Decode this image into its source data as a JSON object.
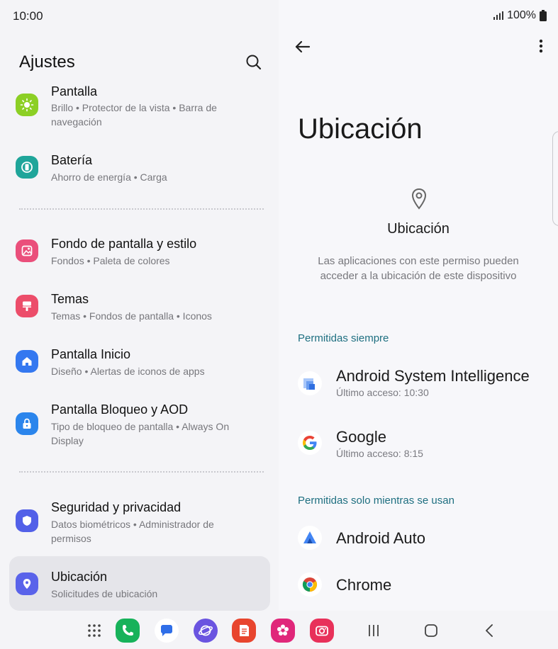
{
  "status": {
    "time": "10:00",
    "battery": "100%"
  },
  "left": {
    "title": "Ajustes",
    "items": [
      {
        "title": "Pantalla",
        "subtitle": "Brillo • Protector de la vista • Barra de navegación",
        "color": "#8ccf25",
        "icon": "sun-icon"
      },
      {
        "title": "Batería",
        "subtitle": "Ahorro de energía • Carga",
        "color": "#1fa59a",
        "icon": "battery-icon"
      },
      {
        "title": "Fondo de pantalla y estilo",
        "subtitle": "Fondos • Paleta de colores",
        "color": "#ea4f7b",
        "icon": "wallpaper-icon"
      },
      {
        "title": "Temas",
        "subtitle": "Temas • Fondos de pantalla • Iconos",
        "color": "#ec4d6a",
        "icon": "theme-brush-icon"
      },
      {
        "title": "Pantalla Inicio",
        "subtitle": "Diseño • Alertas de iconos de apps",
        "color": "#3478f0",
        "icon": "home-icon"
      },
      {
        "title": "Pantalla Bloqueo y AOD",
        "subtitle": "Tipo de bloqueo de pantalla • Always On Display",
        "color": "#2b85ec",
        "icon": "lock-icon"
      },
      {
        "title": "Seguridad y privacidad",
        "subtitle": "Datos biométricos • Administrador de permisos",
        "color": "#5260e8",
        "icon": "shield-icon"
      },
      {
        "title": "Ubicación",
        "subtitle": "Solicitudes de ubicación",
        "color": "#5a63ea",
        "icon": "location-pin-icon"
      }
    ]
  },
  "right": {
    "title": "Ubicación",
    "permission_title": "Ubicación",
    "permission_desc": "Las aplicaciones con este permiso pueden acceder a la ubicación de este dispositivo",
    "section_always": "Permitidas siempre",
    "section_in_use": "Permitidas solo mientras se usan",
    "apps_always": [
      {
        "name": "Android System Intelligence",
        "sub": "Último acceso: 10:30",
        "icon": "android-system-intelligence-icon"
      },
      {
        "name": "Google",
        "sub": "Último acceso: 8:15",
        "icon": "google-icon"
      }
    ],
    "apps_in_use": [
      {
        "name": "Android Auto",
        "icon": "android-auto-icon"
      },
      {
        "name": "Chrome",
        "icon": "chrome-icon"
      }
    ]
  },
  "taskbar": {
    "apps": [
      {
        "name": "apps-grid-icon",
        "color": "#444444"
      },
      {
        "name": "phone-icon",
        "color": "#17b25a"
      },
      {
        "name": "messages-icon",
        "color": "#2f6ee8"
      },
      {
        "name": "internet-icon",
        "color": "#6a54e0"
      },
      {
        "name": "notes-icon",
        "color": "#e8452e"
      },
      {
        "name": "flower-icon",
        "color": "#e0277a"
      },
      {
        "name": "camera-icon",
        "color": "#e8315a"
      }
    ]
  }
}
